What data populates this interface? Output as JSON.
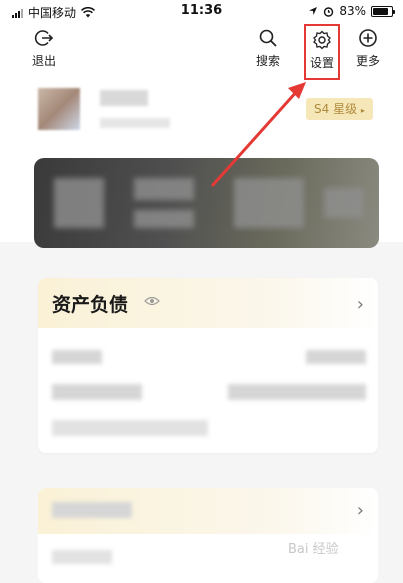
{
  "status_bar": {
    "carrier": "中国移动",
    "time": "11:36",
    "battery_text": "83%",
    "battery_level": 0.83
  },
  "nav": {
    "logout_label": "退出",
    "search_label": "搜索",
    "settings_label": "设置",
    "more_label": "更多"
  },
  "profile": {
    "level_label": "S4 星级",
    "level_icon": "chevron-right-small-icon"
  },
  "assets": {
    "title": "资产负债",
    "eye_icon": "eye-icon",
    "chevron_icon": "chevron-right-icon"
  },
  "watermark": "Bai 经验",
  "colors": {
    "highlight": "#e53935",
    "badge_bg": "#f6e7b8",
    "badge_text": "#b08b3c",
    "card_header_gradient": "#faf1d6"
  }
}
